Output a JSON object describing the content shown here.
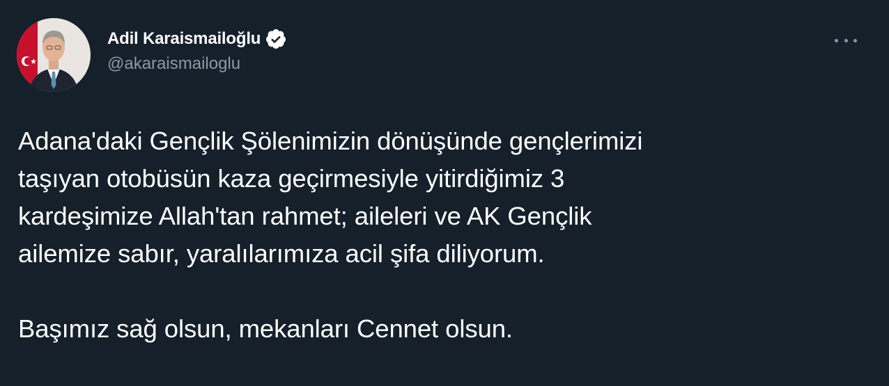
{
  "author": {
    "display_name": "Adil Karaismailoğlu",
    "handle": "@akaraismailoglu",
    "verified": true
  },
  "menu": {
    "icon": "more-horizontal-icon"
  },
  "tweet": {
    "paragraph1": [
      "Adana'daki Gençlik Şölenimizin dönüşünde gençlerimizi",
      "taşıyan otobüsün kaza geçirmesiyle yitirdiğimiz 3",
      "kardeşimize Allah'tan rahmet; aileleri ve AK Gençlik",
      "ailemize sabır, yaralılarımıza acil şifa diliyorum."
    ],
    "paragraph2": "Başımız sağ olsun, mekanları Cennet olsun."
  },
  "colors": {
    "background": "#15202b",
    "text": "#ffffff",
    "secondary_text": "#8b98a5",
    "verified_badge": "#ffffff"
  }
}
